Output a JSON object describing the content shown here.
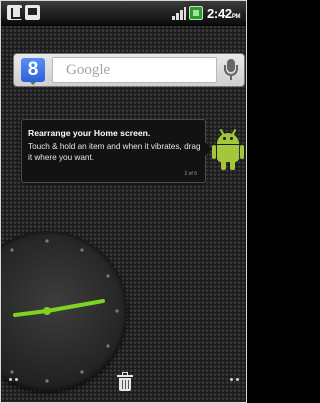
{
  "status_bar": {
    "icons": [
      "usb-icon",
      "sd-card-icon",
      "signal-icon",
      "battery-icon"
    ],
    "time": "2:42",
    "ampm": "PM"
  },
  "search_widget": {
    "logo_letter": "8",
    "placeholder": "Google",
    "mic_icon": "microphone-icon"
  },
  "tip": {
    "title": "Rearrange your Home screen.",
    "body": "Touch & hold an item and when it vibrates, drag it where you want.",
    "page": "2 of 6",
    "illustration_icon": "android-robot-icon"
  },
  "clock_widget": {
    "type": "analog",
    "hand_color": "#7ed321"
  },
  "bottom_bar": {
    "left": "page-indicator-dots-icon",
    "center": "trash-icon",
    "right": "page-indicator-dots-icon"
  },
  "colors": {
    "accent_green": "#a4c639",
    "clock_hands": "#7ed321",
    "google_blue": "#3b74e6"
  }
}
